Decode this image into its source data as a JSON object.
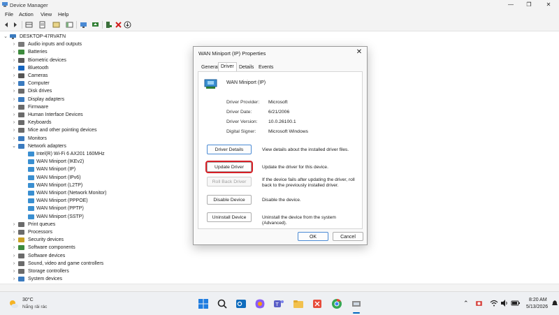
{
  "window": {
    "title": "Device Manager",
    "controls": [
      "—",
      "❐",
      "✕"
    ]
  },
  "menu": [
    "File",
    "Action",
    "View",
    "Help"
  ],
  "tree": {
    "root": "DESKTOP-47RVATN",
    "items": [
      {
        "label": "Audio inputs and outputs",
        "expanded": false,
        "color": "#7a7a7a"
      },
      {
        "label": "Batteries",
        "expanded": false,
        "color": "#3d8b3d"
      },
      {
        "label": "Biometric devices",
        "expanded": false,
        "color": "#5a5a5a"
      },
      {
        "label": "Bluetooth",
        "expanded": false,
        "color": "#1565c0"
      },
      {
        "label": "Cameras",
        "expanded": false,
        "color": "#555555"
      },
      {
        "label": "Computer",
        "expanded": false,
        "color": "#3b7bbf"
      },
      {
        "label": "Disk drives",
        "expanded": false,
        "color": "#6b6b6b"
      },
      {
        "label": "Display adapters",
        "expanded": false,
        "color": "#3b7bbf"
      },
      {
        "label": "Firmware",
        "expanded": false,
        "color": "#6b6b6b"
      },
      {
        "label": "Human Interface Devices",
        "expanded": false,
        "color": "#6b6b6b"
      },
      {
        "label": "Keyboards",
        "expanded": false,
        "color": "#6b6b6b"
      },
      {
        "label": "Mice and other pointing devices",
        "expanded": false,
        "color": "#6b6b6b"
      },
      {
        "label": "Monitors",
        "expanded": false,
        "color": "#3b7bbf"
      },
      {
        "label": "Network adapters",
        "expanded": true,
        "color": "#3b7bbf",
        "children": [
          "Intel(R) Wi-Fi 6 AX201 160MHz",
          "WAN Miniport (IKEv2)",
          "WAN Miniport (IP)",
          "WAN Miniport (IPv6)",
          "WAN Miniport (L2TP)",
          "WAN Miniport (Network Monitor)",
          "WAN Miniport (PPPOE)",
          "WAN Miniport (PPTP)",
          "WAN Miniport (SSTP)"
        ]
      },
      {
        "label": "Print queues",
        "expanded": false,
        "color": "#6b6b6b"
      },
      {
        "label": "Processors",
        "expanded": false,
        "color": "#6b6b6b"
      },
      {
        "label": "Security devices",
        "expanded": false,
        "color": "#c9a227"
      },
      {
        "label": "Software components",
        "expanded": false,
        "color": "#3d8b3d"
      },
      {
        "label": "Software devices",
        "expanded": false,
        "color": "#6b6b6b"
      },
      {
        "label": "Sound, video and game controllers",
        "expanded": false,
        "color": "#6b6b6b"
      },
      {
        "label": "Storage controllers",
        "expanded": false,
        "color": "#6b6b6b"
      },
      {
        "label": "System devices",
        "expanded": false,
        "color": "#3b7bbf"
      }
    ]
  },
  "dialog": {
    "title": "WAN Miniport (IP) Properties",
    "tabs": [
      "General",
      "Driver",
      "Details",
      "Events"
    ],
    "active_tab": "Driver",
    "device_name": "WAN Miniport (IP)",
    "fields": [
      {
        "key": "Driver Provider:",
        "value": "Microsoft"
      },
      {
        "key": "Driver Date:",
        "value": "6/21/2006"
      },
      {
        "key": "Driver Version:",
        "value": "10.0.26100.1"
      },
      {
        "key": "Digital Signer:",
        "value": "Microsoft Windows"
      }
    ],
    "actions": [
      {
        "label": "Driver Details",
        "desc": "View details about the installed driver files.",
        "state": "primary"
      },
      {
        "label": "Update Driver",
        "desc": "Update the driver for this device.",
        "state": "highlighted"
      },
      {
        "label": "Roll Back Driver",
        "desc": "If the device fails after updating the driver, roll back to the previously installed driver.",
        "state": "disabled"
      },
      {
        "label": "Disable Device",
        "desc": "Disable the device.",
        "state": "normal"
      },
      {
        "label": "Uninstall Device",
        "desc": "Uninstall the device from the system (Advanced).",
        "state": "normal"
      }
    ],
    "ok_label": "OK",
    "cancel_label": "Cancel"
  },
  "taskbar": {
    "weather_temp": "30°C",
    "weather_desc": "Nắng rải rác",
    "time": "8:20 AM",
    "date": "5/13/2026",
    "tray_icons": [
      "chevron-up-icon",
      "camera-app-icon",
      "wifi-icon",
      "volume-icon",
      "battery-icon"
    ]
  },
  "colors": {
    "accent": "#0067c0",
    "highlight_box": "#d61f26"
  }
}
